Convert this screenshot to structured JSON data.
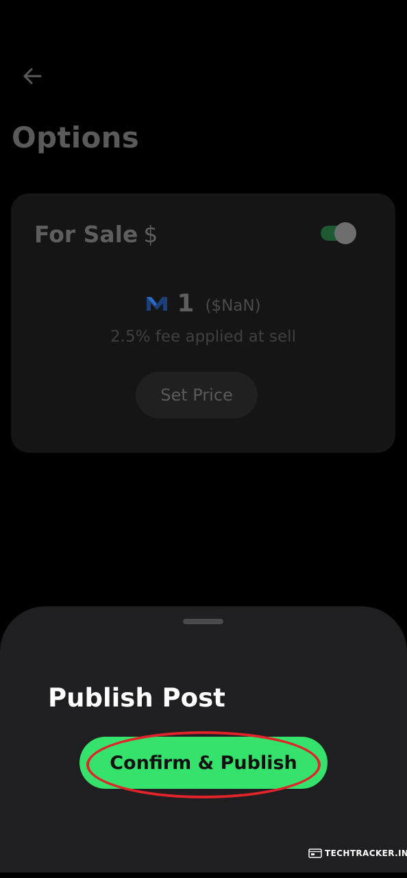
{
  "header": {
    "back_icon": "arrow-left-icon",
    "title": "Options"
  },
  "sale_card": {
    "label": "For Sale",
    "currency_symbol": "$",
    "toggle_on": true,
    "token_icon": "m-token-icon",
    "price_amount": "1",
    "price_fiat": "($NaN)",
    "fee_note": "2.5% fee applied at sell",
    "set_price_label": "Set Price"
  },
  "sheet": {
    "title": "Publish Post",
    "confirm_label": "Confirm & Publish"
  },
  "watermark": {
    "text": "TECHTRACKER.IN"
  },
  "colors": {
    "accent_green": "#35e26b",
    "highlight_red": "#e0242a",
    "sheet_bg": "#1f1f21",
    "toggle_track": "#1d5a33"
  }
}
